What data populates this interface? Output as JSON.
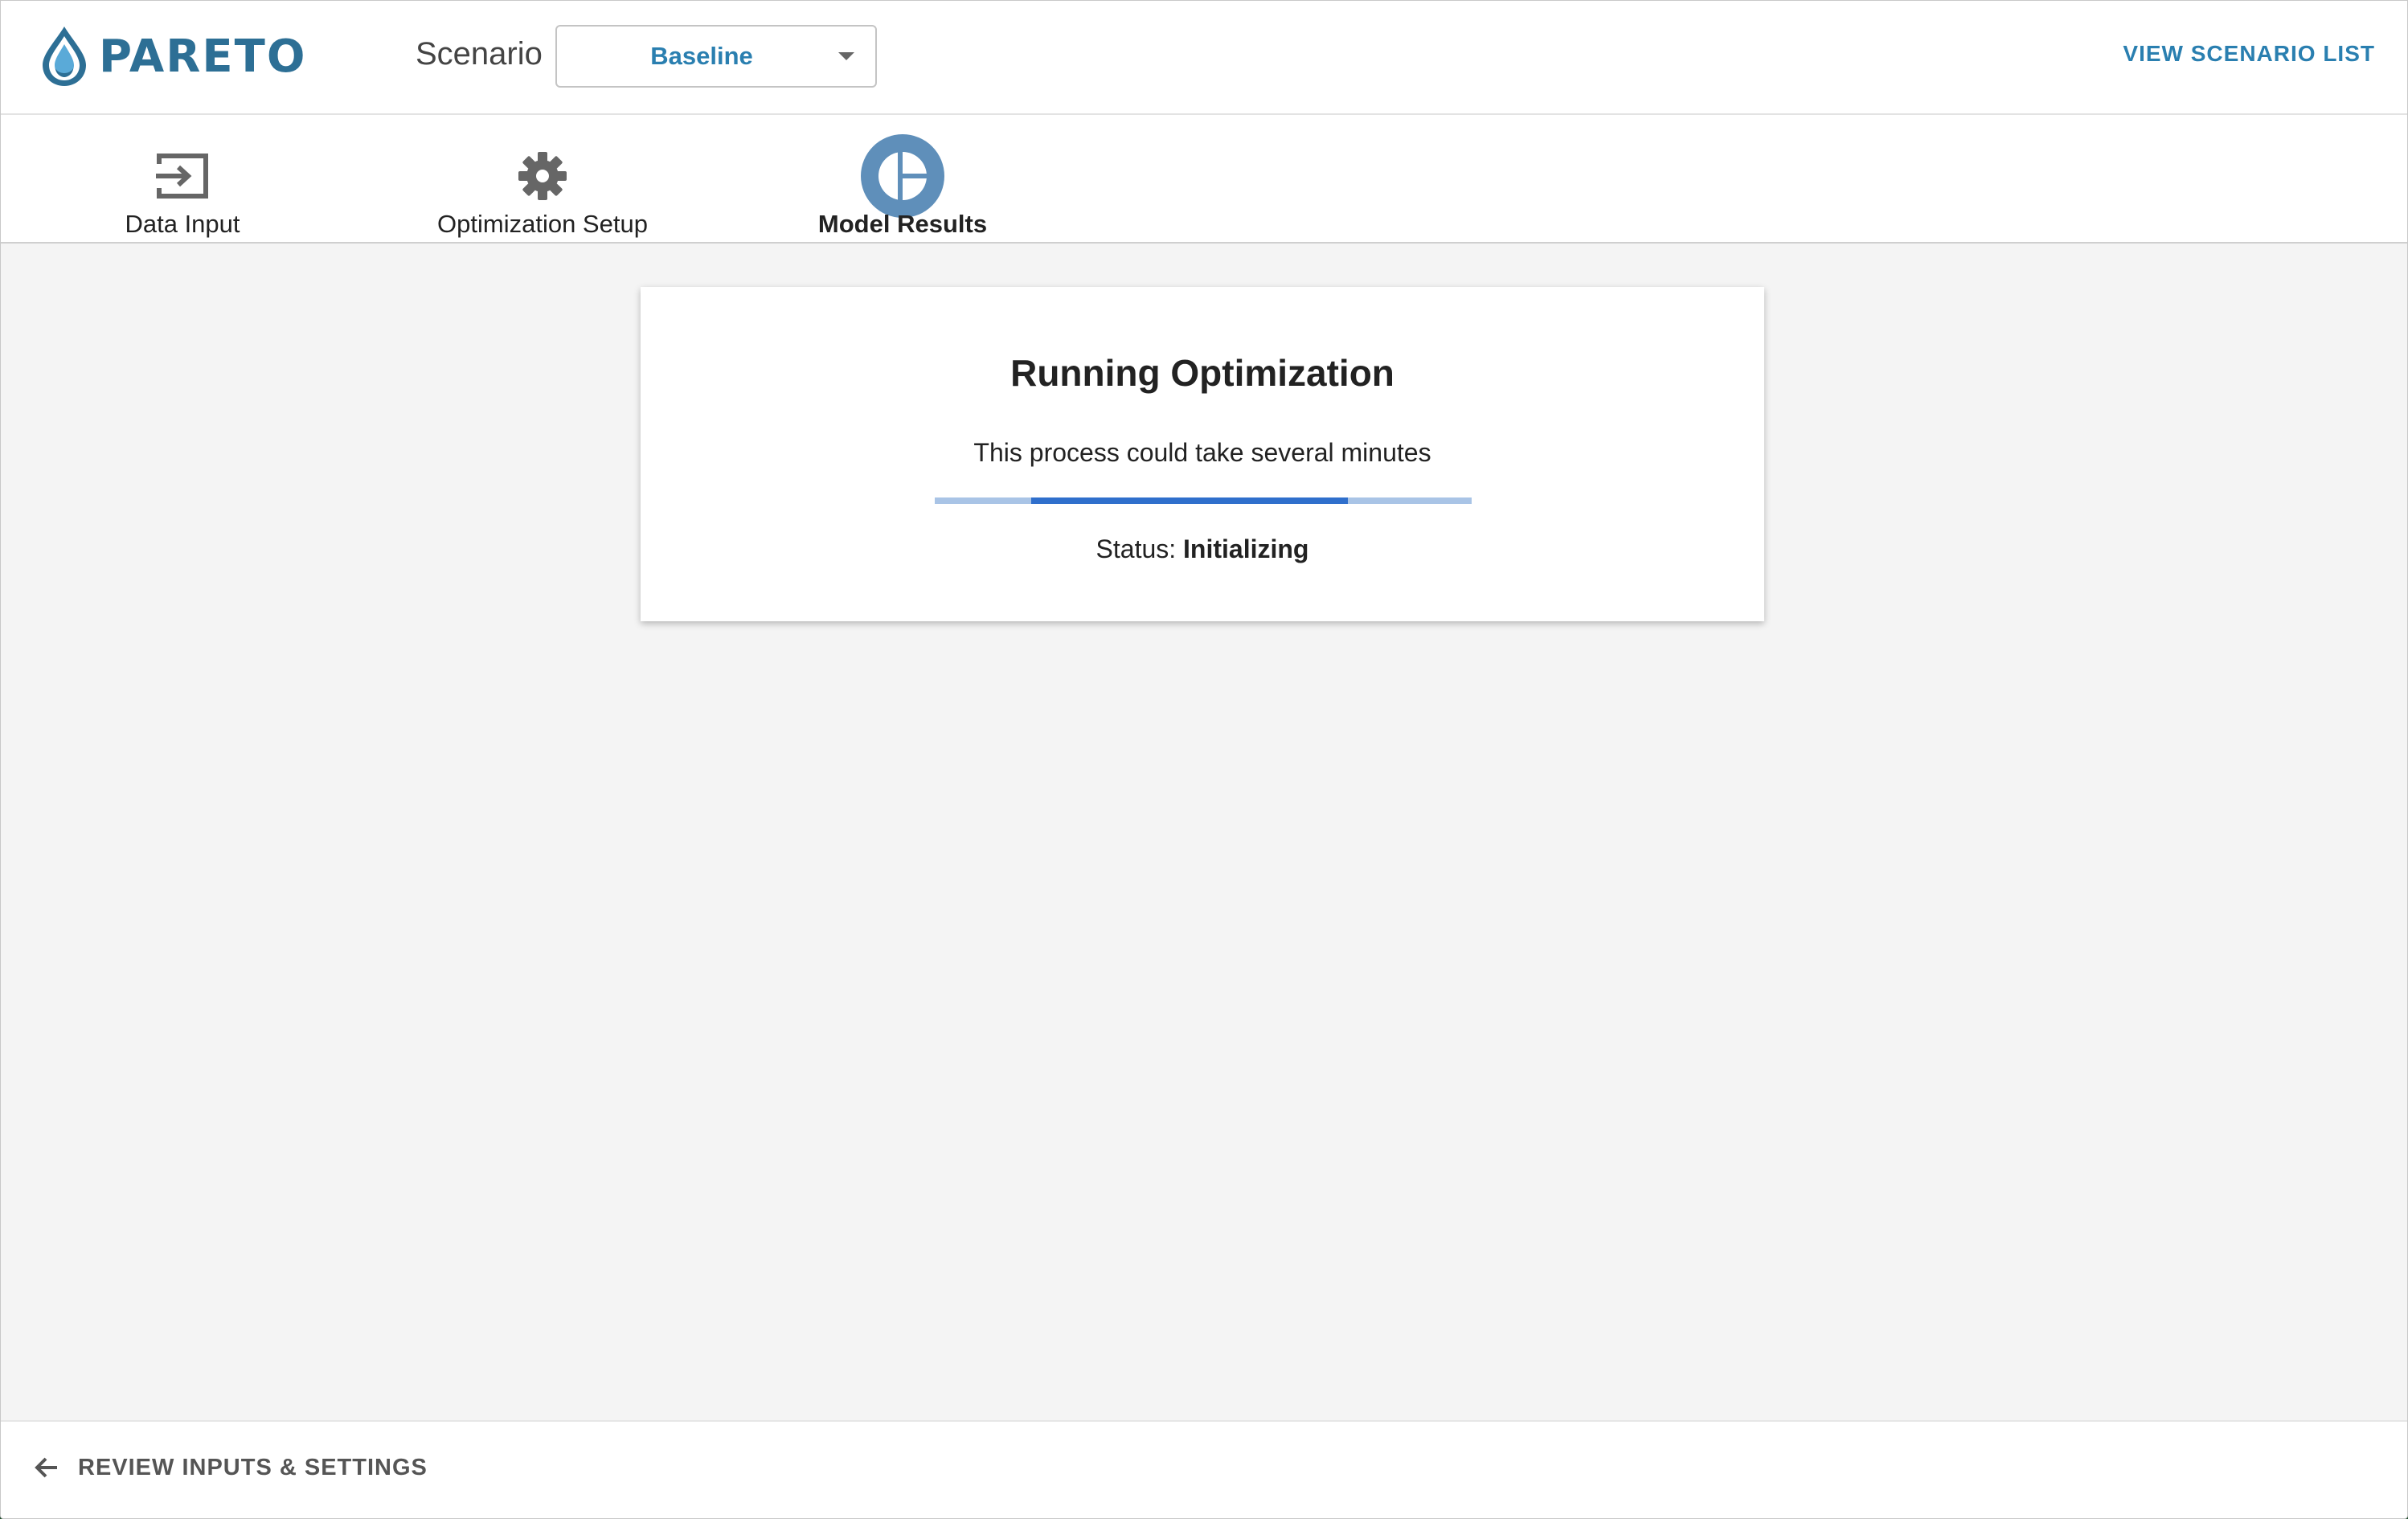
{
  "header": {
    "logo_text": "PARETO",
    "scenario_label": "Scenario",
    "scenario_value": "Baseline",
    "view_list_label": "VIEW SCENARIO LIST"
  },
  "tabs": [
    {
      "label": "Data Input",
      "icon": "input-icon",
      "active": false
    },
    {
      "label": "Optimization Setup",
      "icon": "gear-icon",
      "active": false
    },
    {
      "label": "Model Results",
      "icon": "pie-chart-icon",
      "active": true
    }
  ],
  "card": {
    "title": "Running Optimization",
    "subtitle": "This process could take several minutes",
    "status_label": "Status:",
    "status_value": "Initializing",
    "progress_segment_start": 0.18,
    "progress_segment_end": 0.77
  },
  "footer": {
    "back_label": "REVIEW INPUTS & SETTINGS",
    "back_icon": "arrow-left-icon"
  },
  "colors": {
    "brand": "#2d6f95",
    "accent": "#2a7fb0",
    "active_tab": "#5f8fba",
    "progress_track": "#a9c4e6",
    "progress_fill": "#2f6fcc"
  }
}
